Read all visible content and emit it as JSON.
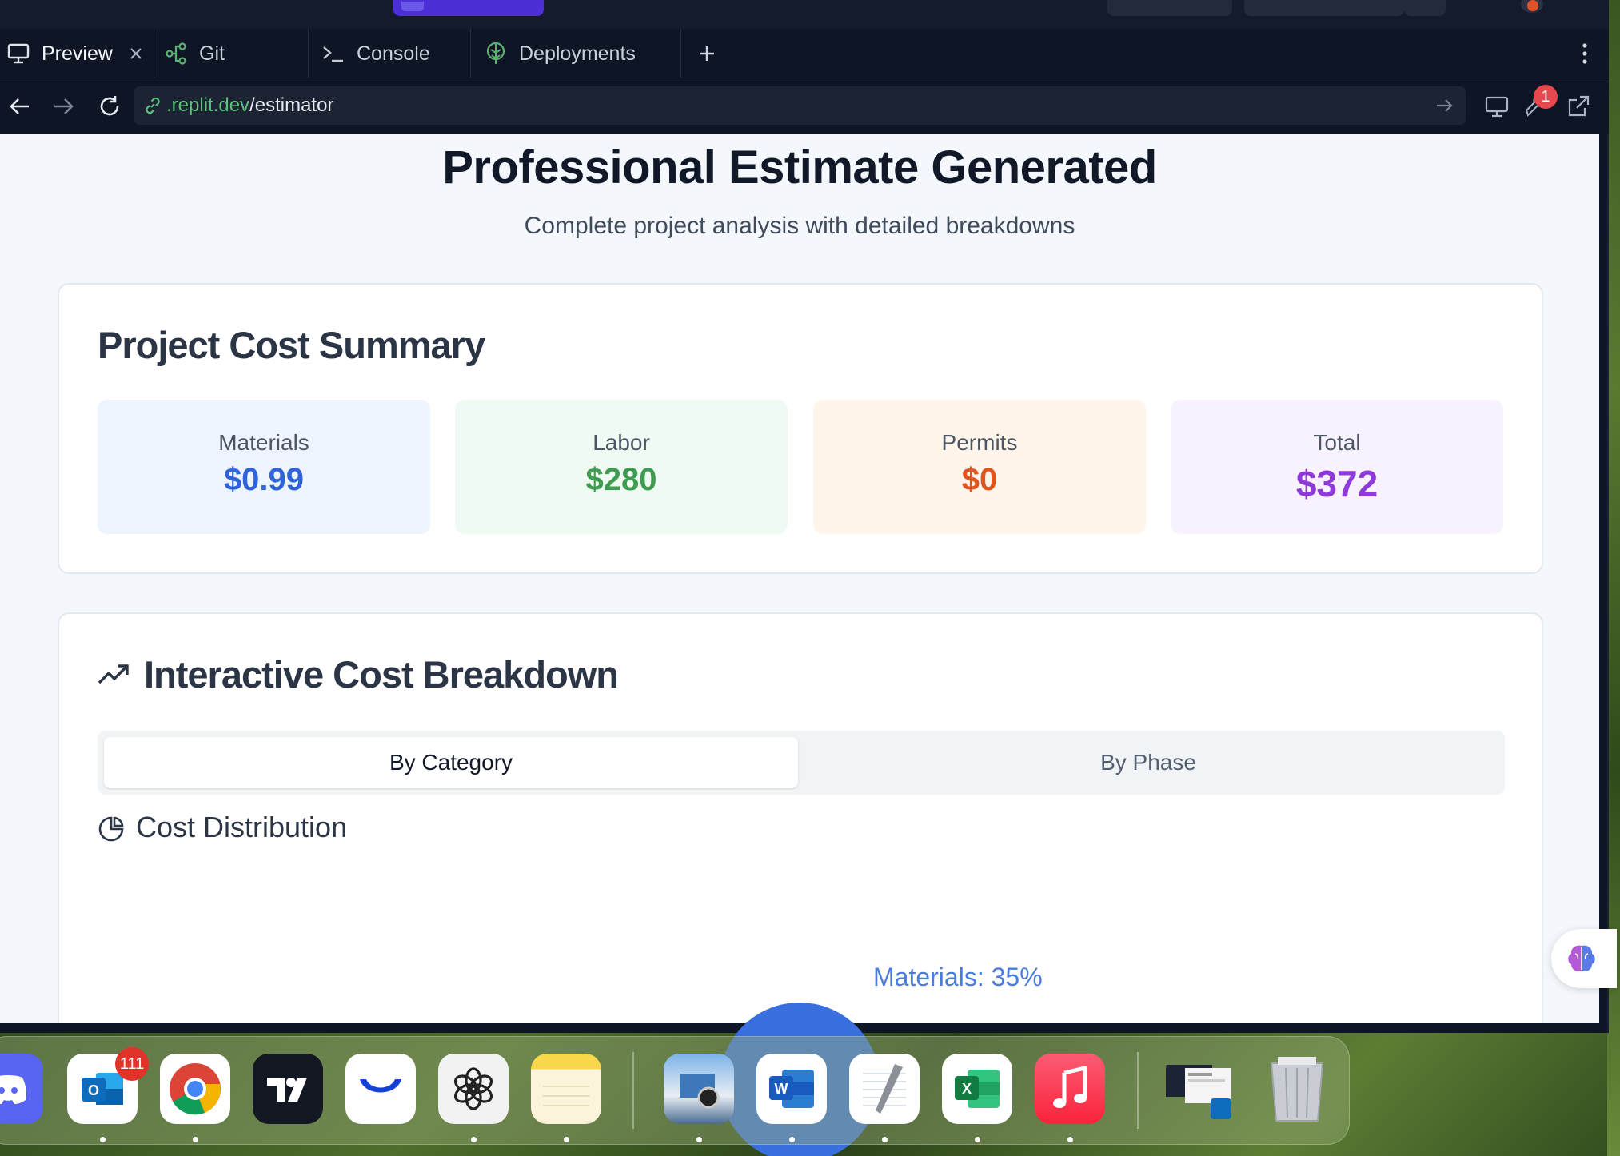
{
  "browser": {
    "tabs": [
      {
        "label": "Preview",
        "icon": "monitor-icon",
        "active": true
      },
      {
        "label": "Git",
        "icon": "git-branch-icon"
      },
      {
        "label": "Console",
        "icon": "terminal-icon"
      },
      {
        "label": "Deployments",
        "icon": "deploy-icon"
      }
    ],
    "url_host": ".replit.dev",
    "url_path": "/estimator",
    "notification_count": "1"
  },
  "page": {
    "title": "Professional Estimate Generated",
    "subtitle": "Complete project analysis with detailed breakdowns",
    "summary": {
      "title": "Project Cost Summary",
      "items": [
        {
          "label": "Materials",
          "value": "$0.99",
          "color": "#2f63d8",
          "bg": "#eef4fe"
        },
        {
          "label": "Labor",
          "value": "$280",
          "color": "#3f9b50",
          "bg": "#effbf2"
        },
        {
          "label": "Permits",
          "value": "$0",
          "color": "#e0551f",
          "bg": "#fff5ea"
        },
        {
          "label": "Total",
          "value": "$372",
          "color": "#8e3ad8",
          "bg": "#f7f2fe"
        }
      ]
    },
    "breakdown": {
      "title": "Interactive Cost Breakdown",
      "tabs": [
        "By Category",
        "By Phase"
      ],
      "section_title": "Cost Distribution",
      "pie_label": "Materials: 35%"
    }
  },
  "chart_data": {
    "type": "pie",
    "slices": [
      {
        "label": "Materials",
        "percent": 35
      }
    ]
  },
  "dock": {
    "apps": [
      "discord-icon",
      "outlook-icon",
      "chrome-icon",
      "tradingview-icon",
      "webull-icon",
      "chatgpt-icon",
      "notes-icon",
      "preview-icon",
      "word-icon",
      "textedit-icon",
      "excel-icon",
      "music-icon",
      "window-stack-icon",
      "trash-icon"
    ],
    "outlook_badge": "111"
  }
}
